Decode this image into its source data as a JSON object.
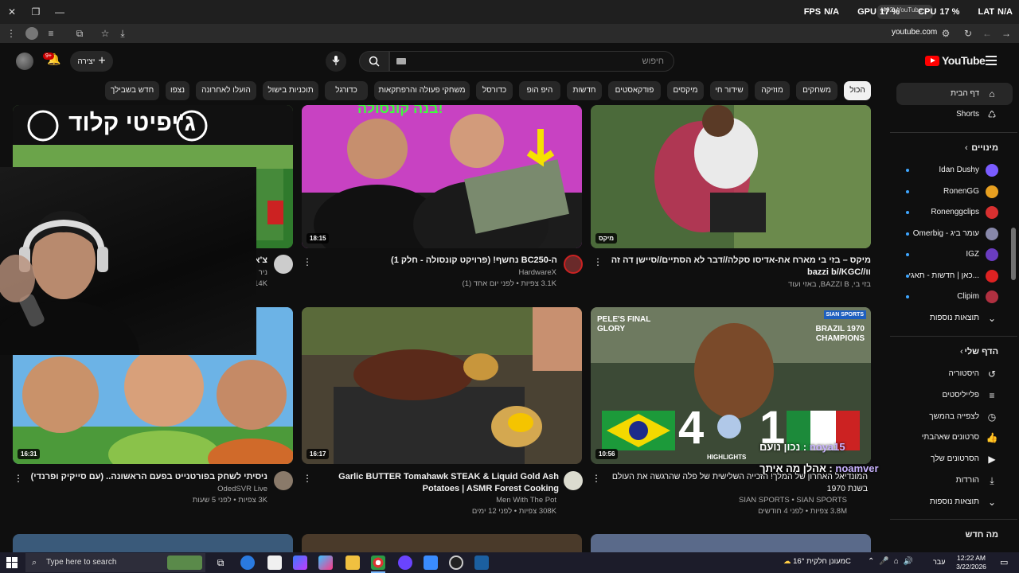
{
  "browser": {
    "tab_title": "(402) YouTube",
    "url": "youtube.com",
    "overlay": {
      "fps_label": "FPS",
      "fps_value": "N/A",
      "gpu_label": "GPU",
      "gpu_value": "17 %",
      "cpu_label": "CPU",
      "cpu_value": "17 %",
      "lat_label": "LAT",
      "lat_value": "N/A"
    }
  },
  "header": {
    "logo_text": "YouTube",
    "search_placeholder": "חיפוש",
    "create_label": "יצירה",
    "notification_count": "9+"
  },
  "chips": [
    "הכול",
    "משחקים",
    "מוזיקה",
    "שידור חי",
    "מיקסים",
    "פודקאסטים",
    "חדשות",
    "היפ הופ",
    "כדורסל",
    "משחקי פעולה והרפתקאות",
    "כדורגל",
    "תוכניות בישול",
    "הועלו לאחרונה",
    "נצפו",
    "חדש בשבילך"
  ],
  "sidebar": {
    "home": "דף הבית",
    "shorts": "Shorts",
    "subscriptions_title": "מינויים",
    "subscriptions": [
      "Idan Dushy",
      "RonenGG",
      "Ronenggclips",
      "Omerbig - עומר ביג",
      "IGZ",
      "כאן | חדשות - תאגי...",
      "Clipim"
    ],
    "show_more": "תוצאות נוספות",
    "you_title": "הדף שלי",
    "you_items": [
      "היסטוריה",
      "פלייליסטים",
      "לצפייה בהמשך",
      "סרטונים שאהבתי",
      "הסרטונים שלך",
      "הורדות",
      "תוצאות נוספות"
    ],
    "whats_new": "מה חדש",
    "colors": {
      "avatar1": "#7a5cff",
      "avatar2": "#e8a020",
      "avatar3": "#d83030",
      "avatar4": "#8888aa",
      "avatar5": "#6a3cc0",
      "avatar6": "#dd2222",
      "avatar7": "#b03040"
    }
  },
  "videos": [
    {
      "title": "מיקס – בזי בי מארח את-אדיסו סקלה//דבר לא הסתיים//סיישן דה זה וו//bazzi b//KGC",
      "channel": "בזי בי, BAZZI B, באזי ועוד",
      "meta": "",
      "duration": "מיקס"
    },
    {
      "title": "ה-BC250 נחשף! (פרויקט קונסולה - חלק 1)",
      "channel": "HardwareX",
      "meta": "3.1K צפיות • לפני יום אחד (1)",
      "duration": "18:15"
    },
    {
      "title": "צ'אטג'יפיטי - קלוד",
      "channel": "ניר ל",
      "meta": "14K",
      "duration": ""
    },
    {
      "title": "המונדיאל האחרון של המלך! הזכייה השלישית של פלה שהרגשה את העולם בשנת 1970",
      "channel": "SIAN SPORTS • SIAN SPORTS",
      "meta": "3.8M צפיות • לפני 4 חודשים",
      "duration": "10:56"
    },
    {
      "title": "Garlic BUTTER Tomahawk STEAK & Liquid Gold Ash Potatoes | ASMR Forest Cooking",
      "channel": "Men With The Pot",
      "meta": "308K צפיות • לפני 12 ימים",
      "duration": "16:17"
    },
    {
      "title": "ניסיתי לשחק בפורטנייט בפעם הראשונה.. (עם סייקיק ופרנדי)",
      "channel": "OdedSVR Live",
      "meta": "3K צפיות • לפני 5 שעות",
      "duration": "16:31"
    }
  ],
  "thumb_text": {
    "row1_left": "ג'יפיטי  קלוד",
    "row1_mid": "בנה קונסולה!",
    "pele_left": "PELE'S FINAL GLORY",
    "pele_right": "BRAZIL 1970 CHAMPIONS",
    "score_left": "4",
    "score_right": "1",
    "highlights": "HIGHLIGHTS",
    "sian": "SIAN SPORTS"
  },
  "chat": [
    {
      "user": "noya15",
      "text": "נכון נועם"
    },
    {
      "user": "noamver",
      "text": "אהלן מה איתך"
    }
  ],
  "taskbar": {
    "search_placeholder": "Type here to search",
    "weather": "מעונן חלקית  16°C",
    "lang": "עבר",
    "time": "12:22 AM",
    "date": "3/22/2026"
  }
}
